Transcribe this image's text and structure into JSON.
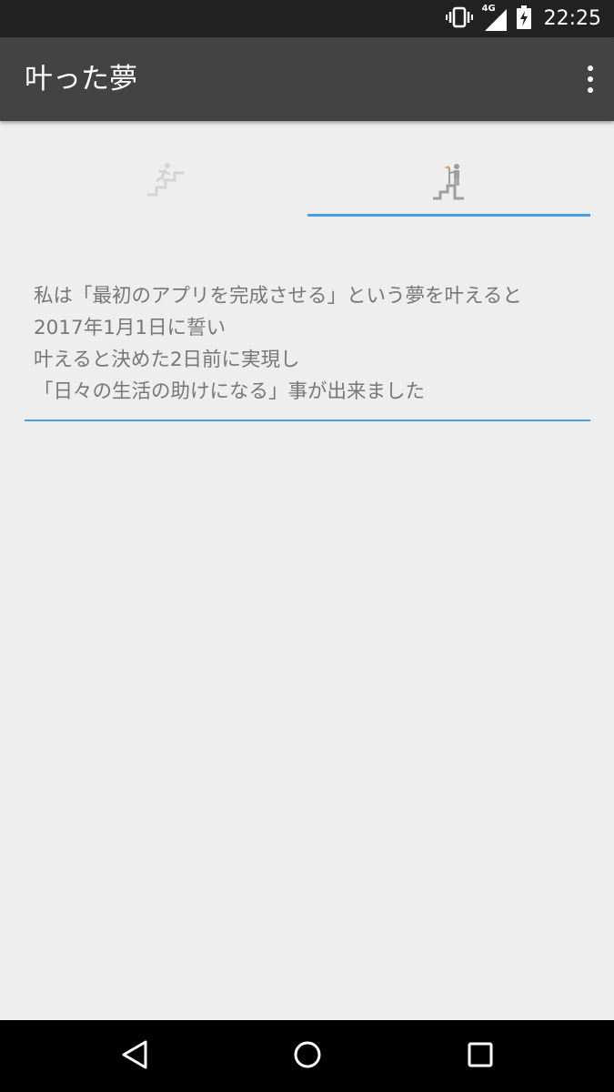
{
  "status_bar": {
    "time": "22:25",
    "network_label": "4G",
    "icons": [
      "vibrate-icon",
      "signal-icon",
      "battery-charging-icon"
    ]
  },
  "app_bar": {
    "title": "叶った夢",
    "overflow_icon": "more-vert-icon"
  },
  "tabs": [
    {
      "icon": "running-stairs-icon",
      "selected": false
    },
    {
      "icon": "summit-flag-icon",
      "selected": true
    }
  ],
  "dream": {
    "lines": [
      "私は「最初のアプリを完成させる」という夢を叶えると",
      "2017年1月1日に誓い",
      "叶えると決めた2日前に実現し",
      "「日々の生活の助けになる」事が出来ました"
    ]
  },
  "nav_bar": {
    "icons": [
      "back-icon",
      "home-icon",
      "recents-icon"
    ]
  },
  "colors": {
    "status_bar": "#222222",
    "app_bar": "#434343",
    "background": "#eeeeee",
    "accent": "#4a9de6",
    "text": "#777777"
  }
}
